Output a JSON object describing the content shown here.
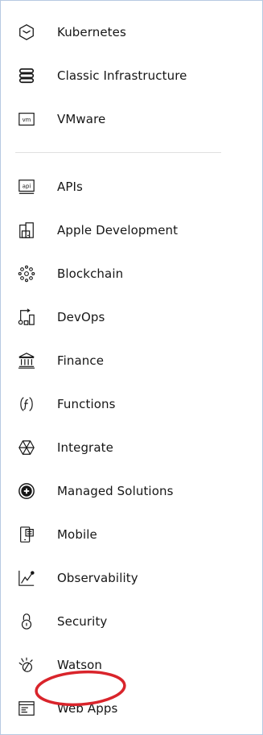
{
  "sections": [
    {
      "items": [
        {
          "label": "Kubernetes",
          "icon": "kubernetes-icon"
        },
        {
          "label": "Classic Infrastructure",
          "icon": "classic-infrastructure-icon"
        },
        {
          "label": "VMware",
          "icon": "vmware-icon",
          "icon_text": "vm"
        }
      ]
    },
    {
      "items": [
        {
          "label": "APIs",
          "icon": "apis-icon",
          "icon_text": "api"
        },
        {
          "label": "Apple Development",
          "icon": "apple-development-icon"
        },
        {
          "label": "Blockchain",
          "icon": "blockchain-icon"
        },
        {
          "label": "DevOps",
          "icon": "devops-icon"
        },
        {
          "label": "Finance",
          "icon": "finance-icon"
        },
        {
          "label": "Functions",
          "icon": "functions-icon"
        },
        {
          "label": "Integrate",
          "icon": "integrate-icon"
        },
        {
          "label": "Managed Solutions",
          "icon": "managed-solutions-icon"
        },
        {
          "label": "Mobile",
          "icon": "mobile-icon"
        },
        {
          "label": "Observability",
          "icon": "observability-icon"
        },
        {
          "label": "Security",
          "icon": "security-icon"
        },
        {
          "label": "Watson",
          "icon": "watson-icon"
        },
        {
          "label": "Web Apps",
          "icon": "web-apps-icon"
        }
      ]
    }
  ],
  "annotation": {
    "target": "Watson",
    "color": "#d9242b"
  }
}
